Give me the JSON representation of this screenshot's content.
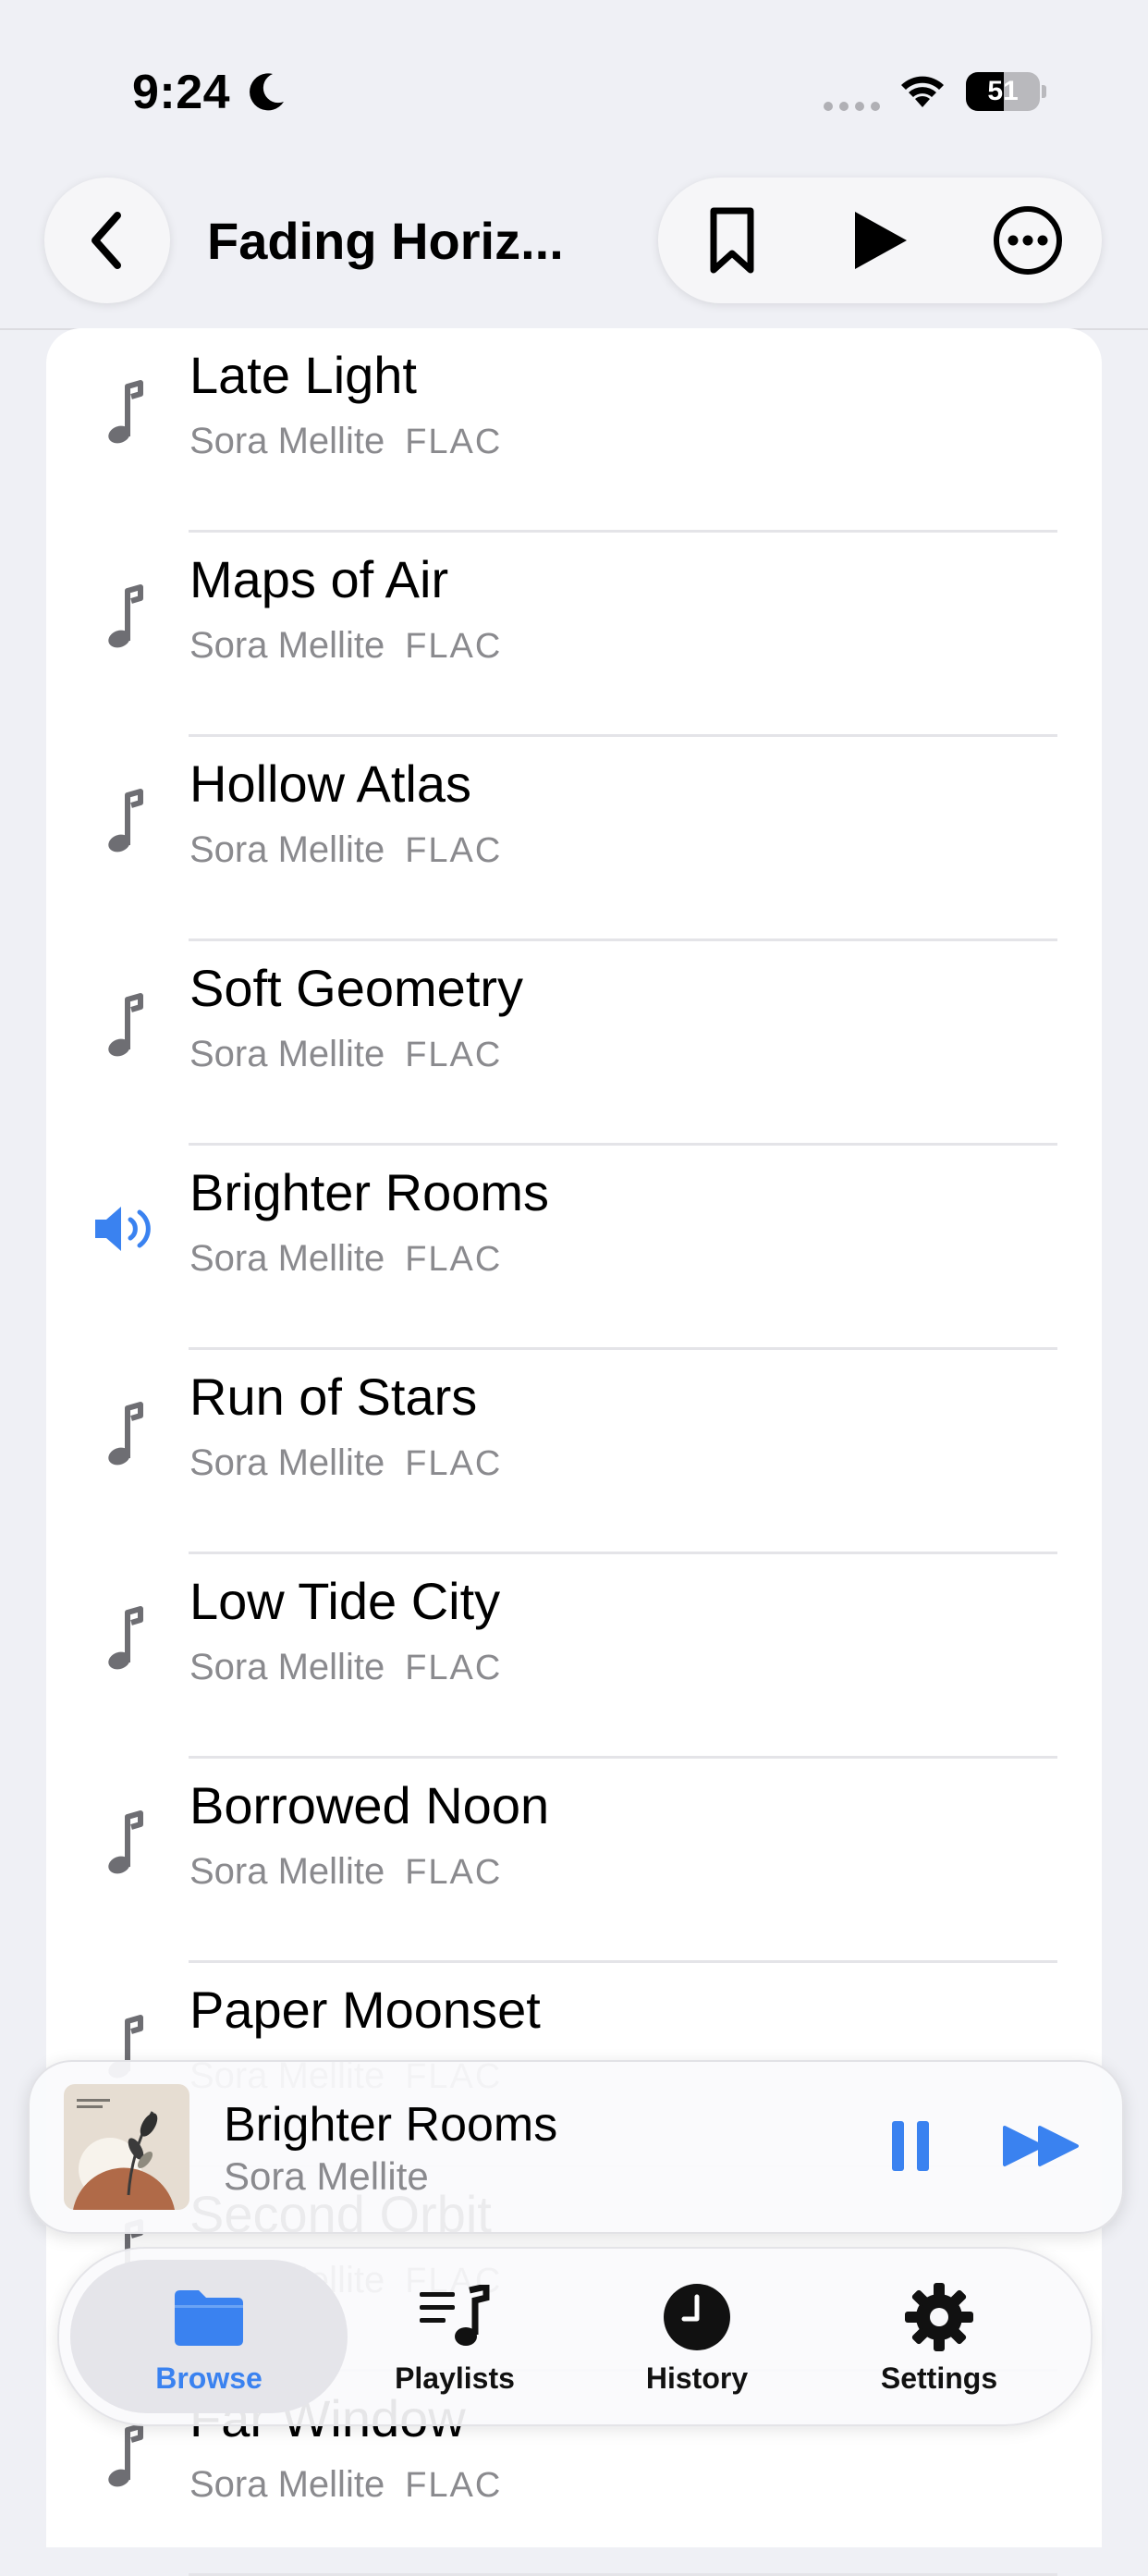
{
  "status_bar": {
    "time": "9:24",
    "battery_level": "51"
  },
  "nav": {
    "title": "Fading Horiz..."
  },
  "tracks": [
    {
      "title": "Late Light",
      "artist": "Sora Mellite",
      "format": "FLAC",
      "playing": false
    },
    {
      "title": "Maps of Air",
      "artist": "Sora Mellite",
      "format": "FLAC",
      "playing": false
    },
    {
      "title": "Hollow Atlas",
      "artist": "Sora Mellite",
      "format": "FLAC",
      "playing": false
    },
    {
      "title": "Soft Geometry",
      "artist": "Sora Mellite",
      "format": "FLAC",
      "playing": false
    },
    {
      "title": "Brighter Rooms",
      "artist": "Sora Mellite",
      "format": "FLAC",
      "playing": true
    },
    {
      "title": "Run of Stars",
      "artist": "Sora Mellite",
      "format": "FLAC",
      "playing": false
    },
    {
      "title": "Low Tide City",
      "artist": "Sora Mellite",
      "format": "FLAC",
      "playing": false
    },
    {
      "title": "Borrowed Noon",
      "artist": "Sora Mellite",
      "format": "FLAC",
      "playing": false
    },
    {
      "title": "Paper Moonset",
      "artist": "Sora Mellite",
      "format": "FLAC",
      "playing": false
    },
    {
      "title": "Second Orbit",
      "artist": "Sora Mellite",
      "format": "FLAC",
      "playing": false
    },
    {
      "title": "Far Window",
      "artist": "Sora Mellite",
      "format": "FLAC",
      "playing": false
    }
  ],
  "now_playing": {
    "title": "Brighter Rooms",
    "artist": "Sora Mellite"
  },
  "tabs": [
    {
      "label": "Browse",
      "icon": "folder-icon",
      "active": true
    },
    {
      "label": "Playlists",
      "icon": "playlist-icon",
      "active": false
    },
    {
      "label": "History",
      "icon": "clock-icon",
      "active": false
    },
    {
      "label": "Settings",
      "icon": "gear-icon",
      "active": false
    }
  ],
  "colors": {
    "accent": "#3a82f0",
    "background": "#eff0f5",
    "secondary_text": "#8a8a8e"
  }
}
